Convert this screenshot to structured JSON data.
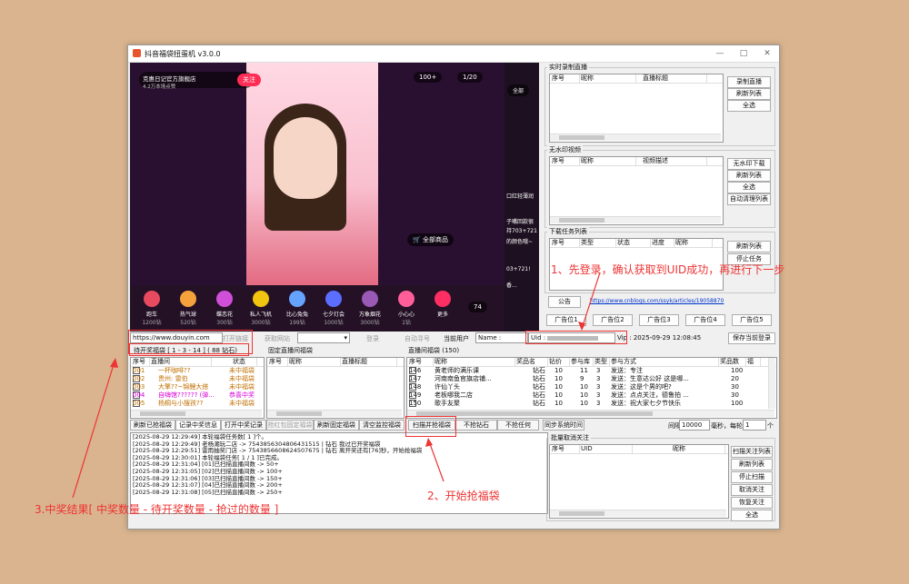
{
  "window": {
    "title": "抖音福袋扭蛋机 v3.0.0",
    "min": "—",
    "max": "□",
    "close": "✕"
  },
  "video": {
    "streamer_name": "克惠日记官方旗舰店",
    "streamer_sub": "4.2万本场点赞",
    "follow": "关注",
    "viewers": "100+",
    "bag": "1/20",
    "product_tag": "全部商品",
    "bubble_count": "74",
    "more": "更多",
    "tabs": [
      "全部"
    ],
    "side_texts": [
      "口红轻薄润",
      "子嘴回款很",
      "持703+721",
      "的颜色哦~",
      "03+721!",
      "香..."
    ],
    "gifts": [
      {
        "name": "跑车",
        "sub": "1200钻",
        "color": "#e84a5f"
      },
      {
        "name": "热气球",
        "sub": "520钻",
        "color": "#f6a23c"
      },
      {
        "name": "蝶恋花",
        "sub": "300钻",
        "color": "#d04fd8"
      },
      {
        "name": "私人飞机",
        "sub": "3000钻",
        "color": "#f1c40f"
      },
      {
        "name": "比心兔兔",
        "sub": "199钻",
        "color": "#66a3ff"
      },
      {
        "name": "七夕灯会",
        "sub": "1000钻",
        "color": "#5b6eff"
      },
      {
        "name": "万象烟花",
        "sub": "3000钻",
        "color": "#9b59b6"
      },
      {
        "name": "小心心",
        "sub": "1钻",
        "color": "#ff5e99"
      },
      {
        "name": "更多",
        "sub": "",
        "color": "#ff2e63"
      }
    ]
  },
  "record": {
    "title": "实时录制直播",
    "cols": [
      "序号",
      "昵称",
      "直播标题"
    ],
    "buttons": [
      "录制直播",
      "刷新列表",
      "全选"
    ]
  },
  "nowatermark": {
    "title": "无水印视频",
    "cols": [
      "序号",
      "昵称",
      "视频描述"
    ],
    "buttons": [
      "无水印下载",
      "刷新列表",
      "全选",
      "自动清理列表"
    ]
  },
  "download": {
    "title": "下载任务列表",
    "cols": [
      "序号",
      "类型",
      "状态",
      "进度",
      "昵称"
    ],
    "buttons": [
      "刷新列表",
      "停止任务"
    ]
  },
  "notice": {
    "label": "公告",
    "link": "https://www.cnblogs.com/ssyk/articles/19058870"
  },
  "ads": [
    "广告位1",
    "广告位2",
    "广告位3",
    "广告位4",
    "广告位5"
  ],
  "toolbar": {
    "url": "https://www.douyin.com",
    "open_link": "打开链接",
    "get_info": "获取网站",
    "login": "登录",
    "auto_refresh": "自动寻号",
    "current_user_label": "当前用户",
    "name_label": "Name :",
    "uid_label": "Uid :",
    "vip": "Vip : 2025-09-29 12:08:45",
    "save_login": "保存当前登录"
  },
  "pending": {
    "title": "待开奖福袋 [ 1 - 3 - 14 ] ( 88 钻石)",
    "cols": [
      "序号",
      "直播间",
      "状态"
    ],
    "rows": [
      {
        "id": "001",
        "room": "一杯咖啡??",
        "status": "未中福袋",
        "color": "#c07000"
      },
      {
        "id": "002",
        "room": "贵州:  雷伯",
        "status": "未中福袋",
        "color": "#c07000"
      },
      {
        "id": "003",
        "room": "大擎??~锦鲤大搭",
        "status": "未中福袋",
        "color": "#c07000"
      },
      {
        "id": "004",
        "room": "自嗨馆?????? (弹...",
        "status": "恭喜中奖",
        "color": "#d400d4"
      },
      {
        "id": "005",
        "room": "杨桐与小搜孩??",
        "status": "未中福袋",
        "color": "#c07000"
      }
    ]
  },
  "fixed": {
    "title": "固定直播间福袋",
    "cols": [
      "序号",
      "昵称",
      "直播标题"
    ]
  },
  "scan": {
    "title": "直播间福袋 (150)",
    "cols": [
      "序号",
      "昵称",
      "奖品名",
      "钻价",
      "参与库",
      "类型",
      "参与方式",
      "奖品数",
      "福"
    ],
    "rows": [
      {
        "id": "146",
        "nick": "黄老师的满乐课",
        "prize": "钻石",
        "price": "10",
        "pool": "11",
        "type": "3",
        "way": "发送：专注",
        "count": "100"
      },
      {
        "id": "147",
        "nick": "河南南鱼官旗店铺...",
        "prize": "钻石",
        "price": "10",
        "pool": "9",
        "type": "3",
        "way": "发送：生意达公好  这是哪...",
        "count": "20"
      },
      {
        "id": "148",
        "nick": "许仙丫头",
        "prize": "钻石",
        "price": "10",
        "pool": "10",
        "type": "3",
        "way": "发送：这是个男的吧?",
        "count": "30"
      },
      {
        "id": "149",
        "nick": "老板哪我二店",
        "prize": "钻石",
        "price": "10",
        "pool": "10",
        "type": "3",
        "way": "发送：点点关注，德鲁拍 ...",
        "count": "30"
      },
      {
        "id": "150",
        "nick": "歌手友聚",
        "prize": "钻石",
        "price": "10",
        "pool": "10",
        "type": "3",
        "way": "发送：祝大家七夕节快乐",
        "count": "100"
      }
    ]
  },
  "left_buttons": [
    "刷新已抢福袋",
    "记录中奖信息",
    "打开中奖记录"
  ],
  "mid_buttons": [
    "抢红包固定福袋",
    "刷新固定福袋",
    "清空监控福袋"
  ],
  "scan_buttons": [
    "扫描并抢福袋",
    "不抢钻石",
    "不抢任何",
    "同步系统时间"
  ],
  "interval": {
    "label": "间隔",
    "value": "10000",
    "unit": "毫秒，每轮抢",
    "count": "1",
    "suffix": "个"
  },
  "log": [
    "[2025-08-29 12:29:49] 本轮福袋任务数[ 1 ]个。",
    "[2025-08-29 12:29:49] 老杨潮玩二店 -> 7543856304806431515 | 钻石 我过已开奖福袋",
    "[2025-08-29 12:29:51] 雷雨抽奖门店 -> 7543856608624507675 | 钻石 离开奖还有[76]秒，开始抢福袋",
    "[2025-08-29 12:30:01] 本轮福袋任务[ 1 / 1 ]已完成。",
    "[2025-08-29 12:31:04] [01]已扫描直播间数 -> 50+",
    "[2025-08-29 12:31:05] [02]已扫描直播间数 -> 100+",
    "[2025-08-29 12:31:06] [03]已扫描直播间数 -> 150+",
    "[2025-08-29 12:31:07] [04]已扫描直播间数 -> 200+",
    "[2025-08-29 12:31:08] [05]已扫描直播间数 -> 250+"
  ],
  "follow_list": {
    "title": "批量取消关注",
    "cols": [
      "序号",
      "UID",
      "昵称"
    ],
    "buttons": [
      "扫描关注列表",
      "刷新列表",
      "停止扫描",
      "取消关注",
      "恢复关注",
      "全选"
    ]
  },
  "annotations": {
    "a1": "1、先登录，确认获取到UID成功，再进行下一步",
    "a2": "2、开始抢福袋",
    "a3": "3.中奖结果[ 中奖数量 - 待开奖数量 - 抢过的数量 ]"
  }
}
